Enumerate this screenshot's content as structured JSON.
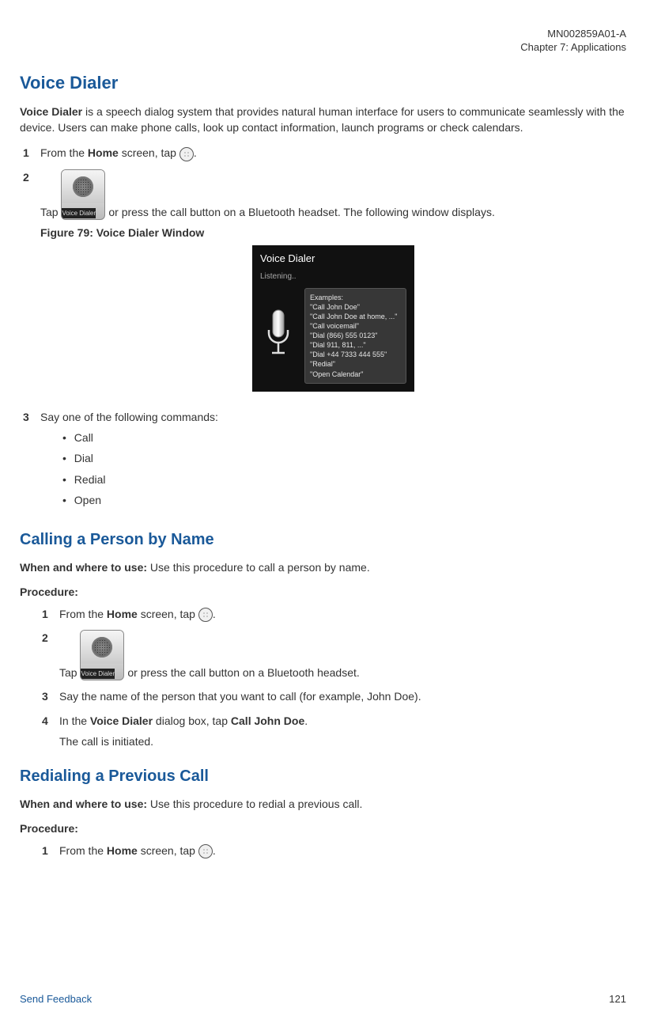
{
  "meta": {
    "doc_id": "MN002859A01-A",
    "chapter": "Chapter 7:  Applications"
  },
  "s1": {
    "title": "Voice Dialer",
    "intro_bold": "Voice Dialer",
    "intro_rest": " is a speech dialog system that provides natural human interface for users to communicate seamlessly with the device. Users can make phone calls, look up contact information, launch programs or check calendars.",
    "step1_pre": "From the ",
    "step1_bold": "Home",
    "step1_post": " screen, tap ",
    "step1_end": ".",
    "vd_icon_label": "Voice Dialer",
    "step2_pre": "Tap ",
    "step2_post": " or press the call button on a Bluetooth headset. The following window displays.",
    "fig_caption": "Figure 79: Voice Dialer Window",
    "vd_window": {
      "title": "Voice Dialer",
      "listening": "Listening..",
      "ex_label": "Examples:",
      "ex1": "\"Call John Doe\"",
      "ex2": "\"Call John Doe at home, ...\"",
      "ex3": "\"Call voicemail\"",
      "ex4": "\"Dial (866) 555 0123\"",
      "ex5": "\"Dial 911, 811, ...\"",
      "ex6": "\"Dial +44 7333 444 555\"",
      "ex7": "\"Redial\"",
      "ex8": "\"Open Calendar\""
    },
    "step3": "Say one of the following commands:",
    "cmd1": "Call",
    "cmd2": "Dial",
    "cmd3": "Redial",
    "cmd4": "Open"
  },
  "s2": {
    "title": "Calling a Person by Name",
    "when_bold": "When and where to use:",
    "when_rest": " Use this procedure to call a person by name.",
    "procedure": "Procedure:",
    "p1_pre": "From the ",
    "p1_bold": "Home",
    "p1_post": " screen, tap ",
    "p1_end": ".",
    "vd_icon_label": "Voice Dialer",
    "p2_pre": "Tap ",
    "p2_post": " or press the call button on a Bluetooth headset.",
    "p3": "Say the name of the person that you want to call (for example, John Doe).",
    "p4_pre": "In the ",
    "p4_bold1": "Voice Dialer",
    "p4_mid": " dialog box, tap ",
    "p4_bold2": "Call John Doe",
    "p4_end": ".",
    "p4_result": "The call is initiated."
  },
  "s3": {
    "title": "Redialing a Previous Call",
    "when_bold": "When and where to use:",
    "when_rest": " Use this procedure to redial a previous call.",
    "procedure": "Procedure:",
    "p1_pre": "From the ",
    "p1_bold": "Home",
    "p1_post": " screen, tap ",
    "p1_end": "."
  },
  "footer": {
    "link": "Send Feedback",
    "page": "121"
  },
  "nums": {
    "n1": "1",
    "n2": "2",
    "n3": "3",
    "n4": "4"
  }
}
